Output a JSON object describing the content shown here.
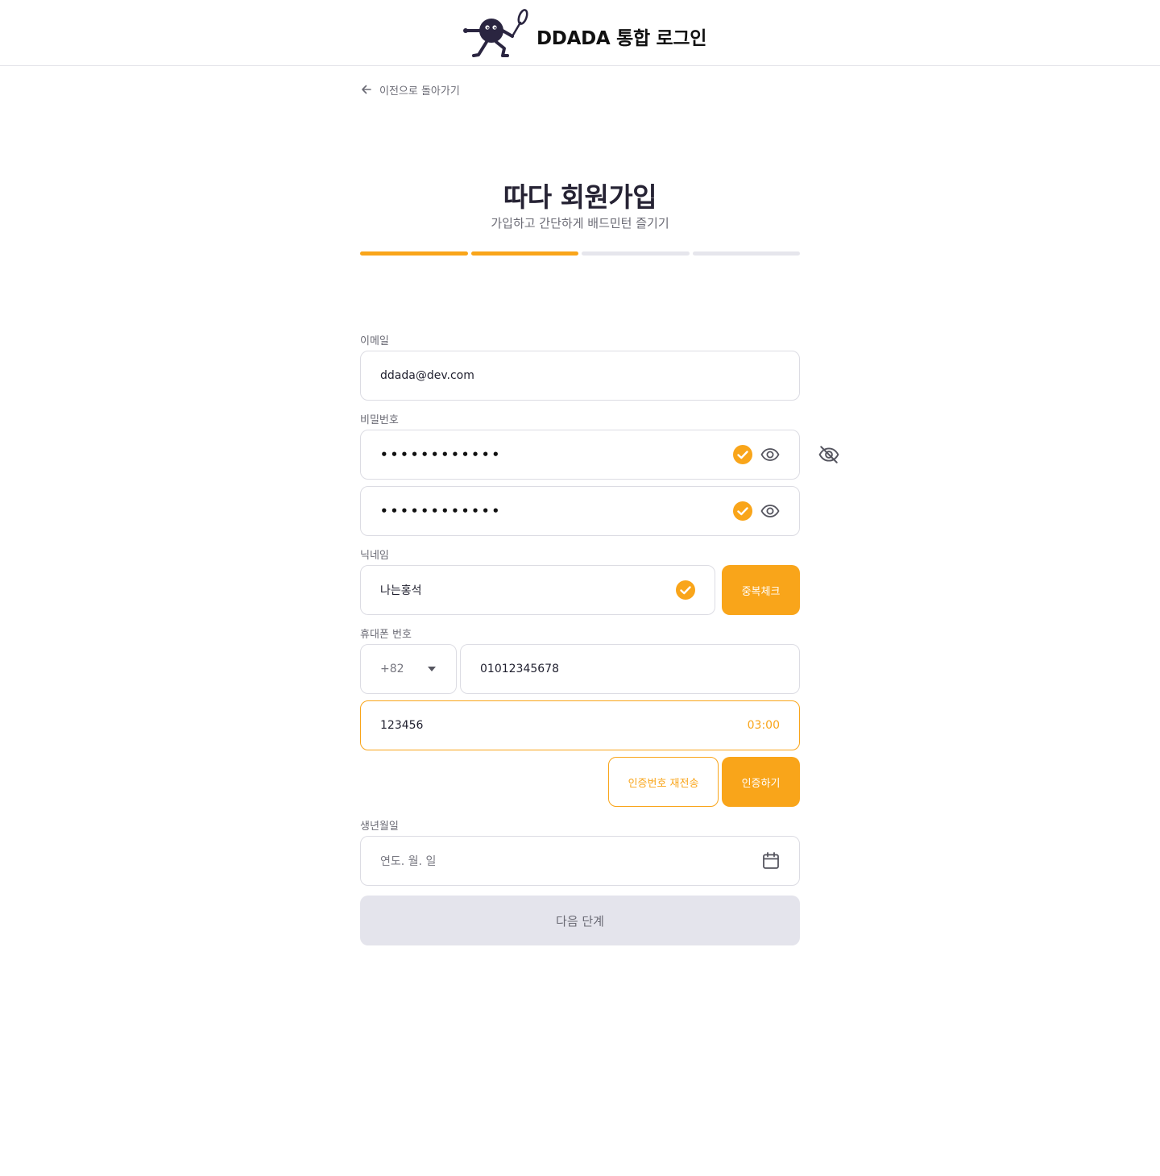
{
  "header": {
    "brand": "DDADA 통합 로그인",
    "logo_icon": "badminton-mascot-icon"
  },
  "nav": {
    "back_label": "이전으로 돌아가기",
    "back_icon": "arrow-left-icon"
  },
  "page": {
    "title": "따다 회원가입",
    "subtitle": "가입하고 간단하게 배드민턴 즐기기"
  },
  "progress": {
    "total_steps": 4,
    "current_step": 2,
    "active_color": "#f9a51a",
    "inactive_color": "#e6e6ec"
  },
  "form": {
    "email": {
      "label": "이메일",
      "value": "ddada@dev.com"
    },
    "password": {
      "label": "비밀번호",
      "value": "••••••••••••",
      "confirm_value": "••••••••••••",
      "valid": true,
      "check_icon": "check-circle-icon",
      "eye_icon": "eye-icon",
      "hidden_icon": "eye-off-icon"
    },
    "nickname": {
      "label": "닉네임",
      "value": "나는홍석",
      "valid": true,
      "check_button": "중복체크"
    },
    "phone": {
      "label": "휴대폰 번호",
      "country_code": "+82",
      "number": "01012345678",
      "code": "123456",
      "timer": "03:00",
      "resend_button": "인증번호 재전송",
      "verify_button": "인증하기",
      "dropdown_icon": "caret-down-icon"
    },
    "birthdate": {
      "label": "생년월일",
      "placeholder": "연도. 월. 일",
      "calendar_icon": "calendar-icon"
    },
    "submit_button": "다음 단계"
  },
  "colors": {
    "accent": "#f9a51a",
    "disabled_bg": "#e4e4ec",
    "text_dark": "#262334",
    "text_muted": "#6b6b75"
  }
}
